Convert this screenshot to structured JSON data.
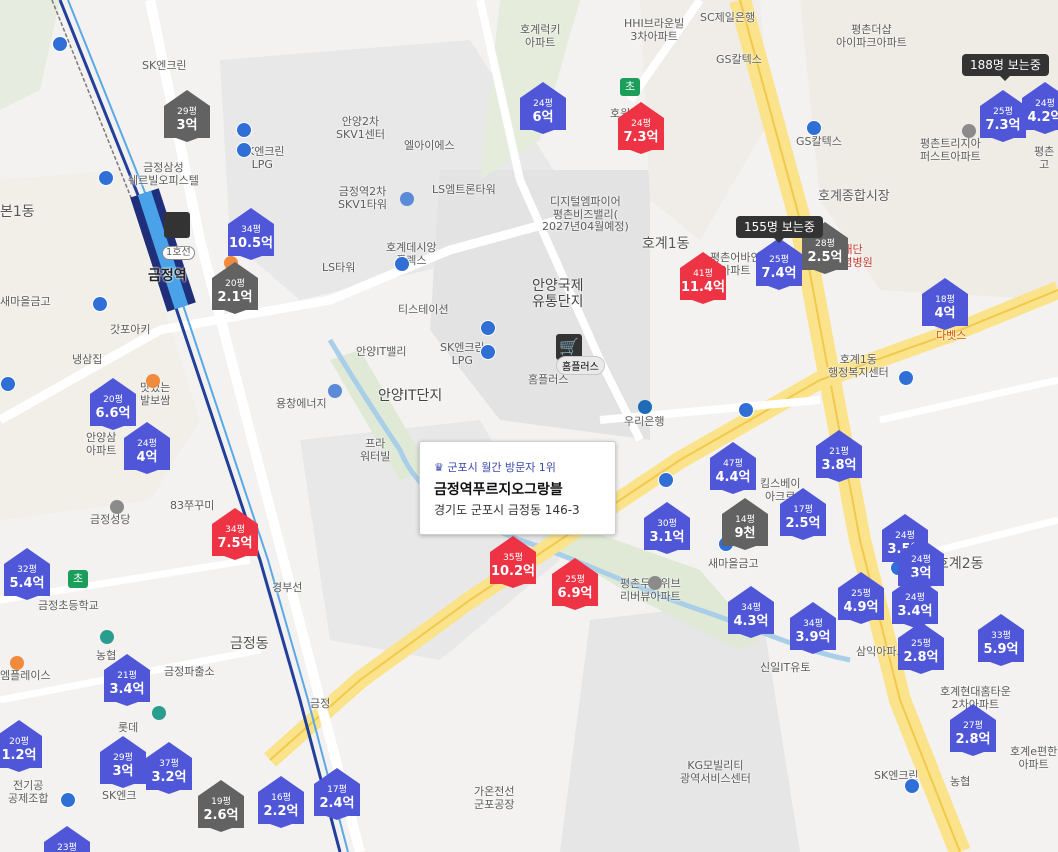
{
  "popup": {
    "badge": "♛ 군포시 월간 방문자 1위",
    "title": "금정역푸르지오그랑블",
    "address": "경기도 군포시 금정동 146-3"
  },
  "bubbles": [
    {
      "id": "b1",
      "text": "188명 보는중"
    },
    {
      "id": "b2",
      "text": "155명 보는중"
    }
  ],
  "markers": [
    {
      "id": "m1",
      "size": "29평",
      "price": "3억",
      "color": "grey"
    },
    {
      "id": "m2",
      "size": "34평",
      "price": "10.5억",
      "color": "blue"
    },
    {
      "id": "m3",
      "size": "20평",
      "price": "2.1억",
      "color": "grey"
    },
    {
      "id": "m4",
      "size": "24평",
      "price": "6억",
      "color": "blue"
    },
    {
      "id": "m5",
      "size": "24평",
      "price": "7.3억",
      "color": "red"
    },
    {
      "id": "m6",
      "size": "41평",
      "price": "11.4억",
      "color": "red"
    },
    {
      "id": "m7",
      "size": "25평",
      "price": "7.4억",
      "color": "blue"
    },
    {
      "id": "m8",
      "size": "28평",
      "price": "2.5억",
      "color": "grey"
    },
    {
      "id": "m9",
      "size": "25평",
      "price": "7.3억",
      "color": "blue"
    },
    {
      "id": "m10",
      "size": "24평",
      "price": "4.2억",
      "color": "blue"
    },
    {
      "id": "m11",
      "size": "18평",
      "price": "4억",
      "color": "blue"
    },
    {
      "id": "m12",
      "size": "20평",
      "price": "6.6억",
      "color": "blue"
    },
    {
      "id": "m13",
      "size": "24평",
      "price": "4억",
      "color": "blue"
    },
    {
      "id": "m14",
      "size": "34평",
      "price": "7.5억",
      "color": "red"
    },
    {
      "id": "m15",
      "size": "32평",
      "price": "5.4억",
      "color": "blue"
    },
    {
      "id": "m16",
      "size": "21평",
      "price": "3.4억",
      "color": "blue"
    },
    {
      "id": "m17",
      "size": "20평",
      "price": "1.2억",
      "color": "blue"
    },
    {
      "id": "m18",
      "size": "29평",
      "price": "3억",
      "color": "blue"
    },
    {
      "id": "m19",
      "size": "37평",
      "price": "3.2억",
      "color": "blue"
    },
    {
      "id": "m20",
      "size": "19평",
      "price": "2.6억",
      "color": "grey"
    },
    {
      "id": "m21",
      "size": "16평",
      "price": "2.2억",
      "color": "blue"
    },
    {
      "id": "m22",
      "size": "17평",
      "price": "2.4억",
      "color": "blue"
    },
    {
      "id": "m23",
      "size": "35평",
      "price": "10.2억",
      "color": "red"
    },
    {
      "id": "m24",
      "size": "25평",
      "price": "6.9억",
      "color": "red"
    },
    {
      "id": "m25",
      "size": "47평",
      "price": "4.4억",
      "color": "blue"
    },
    {
      "id": "m26",
      "size": "30평",
      "price": "3.1억",
      "color": "blue"
    },
    {
      "id": "m27",
      "size": "14평",
      "price": "9천",
      "color": "grey"
    },
    {
      "id": "m28",
      "size": "17평",
      "price": "2.5억",
      "color": "blue"
    },
    {
      "id": "m29",
      "size": "21평",
      "price": "3.8억",
      "color": "blue"
    },
    {
      "id": "m30",
      "size": "24평",
      "price": "3.5억",
      "color": "blue"
    },
    {
      "id": "m31",
      "size": "24평",
      "price": "3억",
      "color": "blue"
    },
    {
      "id": "m32",
      "size": "34평",
      "price": "4.3억",
      "color": "blue"
    },
    {
      "id": "m33",
      "size": "34평",
      "price": "3.9억",
      "color": "blue"
    },
    {
      "id": "m34",
      "size": "25평",
      "price": "4.9억",
      "color": "blue"
    },
    {
      "id": "m35",
      "size": "24평",
      "price": "3.4억",
      "color": "blue"
    },
    {
      "id": "m36",
      "size": "25평",
      "price": "2.8억",
      "color": "blue"
    },
    {
      "id": "m37",
      "size": "33평",
      "price": "5.9억",
      "color": "blue"
    },
    {
      "id": "m38",
      "size": "27평",
      "price": "2.8억",
      "color": "blue"
    },
    {
      "id": "m39",
      "size": "23평",
      "price": "",
      "color": "blue"
    }
  ],
  "labels": [
    {
      "id": "l1",
      "text": "SK엔크린"
    },
    {
      "id": "l2",
      "text": "금정삼성\n쉐르빌오피스텔"
    },
    {
      "id": "l3",
      "text": "SK엔크린\nLPG"
    },
    {
      "id": "l4",
      "text": "금정역"
    },
    {
      "id": "l5",
      "text": "1호선"
    },
    {
      "id": "l6",
      "text": "새마을금고"
    },
    {
      "id": "l7",
      "text": "갓포아키"
    },
    {
      "id": "l8",
      "text": "냉삼집"
    },
    {
      "id": "l9",
      "text": "맛있는\n발보쌈"
    },
    {
      "id": "l10",
      "text": "안양삼\n아파트"
    },
    {
      "id": "l11",
      "text": "금정성당"
    },
    {
      "id": "l12",
      "text": "83쭈꾸미"
    },
    {
      "id": "l13",
      "text": "금정초등학교"
    },
    {
      "id": "l14",
      "text": "농협"
    },
    {
      "id": "l15",
      "text": "금정파출소"
    },
    {
      "id": "l16",
      "text": "금정동"
    },
    {
      "id": "l17",
      "text": "롯데"
    },
    {
      "id": "l18",
      "text": "SK엔크"
    },
    {
      "id": "l19",
      "text": "전기공\n공제조합"
    },
    {
      "id": "l20",
      "text": "엠플레이스"
    },
    {
      "id": "l21",
      "text": "안양2차\nSKV1센터"
    },
    {
      "id": "l22",
      "text": "엘아이에스"
    },
    {
      "id": "l23",
      "text": "금정역2차\nSKV1타워"
    },
    {
      "id": "l24",
      "text": "LS엠트론타워"
    },
    {
      "id": "l25",
      "text": "호계데시앙\n플렉스"
    },
    {
      "id": "l26",
      "text": "LS타워"
    },
    {
      "id": "l27",
      "text": "티스테이션"
    },
    {
      "id": "l28",
      "text": "안양IT밸리"
    },
    {
      "id": "l29",
      "text": "SK엔크린\nLPG"
    },
    {
      "id": "l30",
      "text": "용창에너지"
    },
    {
      "id": "l31",
      "text": "안양IT단지"
    },
    {
      "id": "l32",
      "text": "프라\n워터빌"
    },
    {
      "id": "l33",
      "text": "디지털엠파이어\n평촌비즈밸리(\n2027년04월예정)"
    },
    {
      "id": "l34",
      "text": "안양국제\n유통단지"
    },
    {
      "id": "l35",
      "text": "홈플러스"
    },
    {
      "id": "l36",
      "text": "우리은행"
    },
    {
      "id": "l37",
      "text": "호계럭키\n아파트"
    },
    {
      "id": "l38",
      "text": "HHI브라운빌\n3차아파트"
    },
    {
      "id": "l39",
      "text": "SC제일은행"
    },
    {
      "id": "l40",
      "text": "GS칼텍스"
    },
    {
      "id": "l41",
      "text": "GS칼텍스"
    },
    {
      "id": "l42",
      "text": "평촌더샵\n아이파크아파트"
    },
    {
      "id": "l43",
      "text": "평촌트리지아\n퍼스트아파트"
    },
    {
      "id": "l44",
      "text": "호계종합시장"
    },
    {
      "id": "l45",
      "text": "호계1동"
    },
    {
      "id": "l46",
      "text": "평촌어바인\n아파트"
    },
    {
      "id": "l47",
      "text": "의료재단\n송근기념병원"
    },
    {
      "id": "l48",
      "text": "다벳스"
    },
    {
      "id": "l49",
      "text": "호계1동\n행정복지센터"
    },
    {
      "id": "l50",
      "text": "킴스베이\n아크로"
    },
    {
      "id": "l51",
      "text": "새마을금고"
    },
    {
      "id": "l52",
      "text": "평촌두산위브\n리버뷰아파트"
    },
    {
      "id": "l53",
      "text": "신일IT유토"
    },
    {
      "id": "l54",
      "text": "삼익아파트"
    },
    {
      "id": "l55",
      "text": "호계현대홈타운\n2차아파트"
    },
    {
      "id": "l56",
      "text": "KG모빌리티\n광역서비스센터"
    },
    {
      "id": "l57",
      "text": "가온전선\n군포공장"
    },
    {
      "id": "l58",
      "text": "SK엔크린"
    },
    {
      "id": "l59",
      "text": "농협"
    },
    {
      "id": "l60",
      "text": "호계e편한\n아파트"
    },
    {
      "id": "l61",
      "text": "본1동"
    },
    {
      "id": "l62",
      "text": "호계2동"
    },
    {
      "id": "l63",
      "text": "호원초"
    },
    {
      "id": "l64",
      "text": "금정"
    },
    {
      "id": "l65",
      "text": "평촌\n고"
    },
    {
      "id": "l66",
      "text": "경부선"
    }
  ],
  "school_badges": [
    {
      "id": "sb1",
      "text": "초"
    },
    {
      "id": "sb2",
      "text": "초"
    }
  ],
  "store": {
    "label": "홈플러스"
  }
}
